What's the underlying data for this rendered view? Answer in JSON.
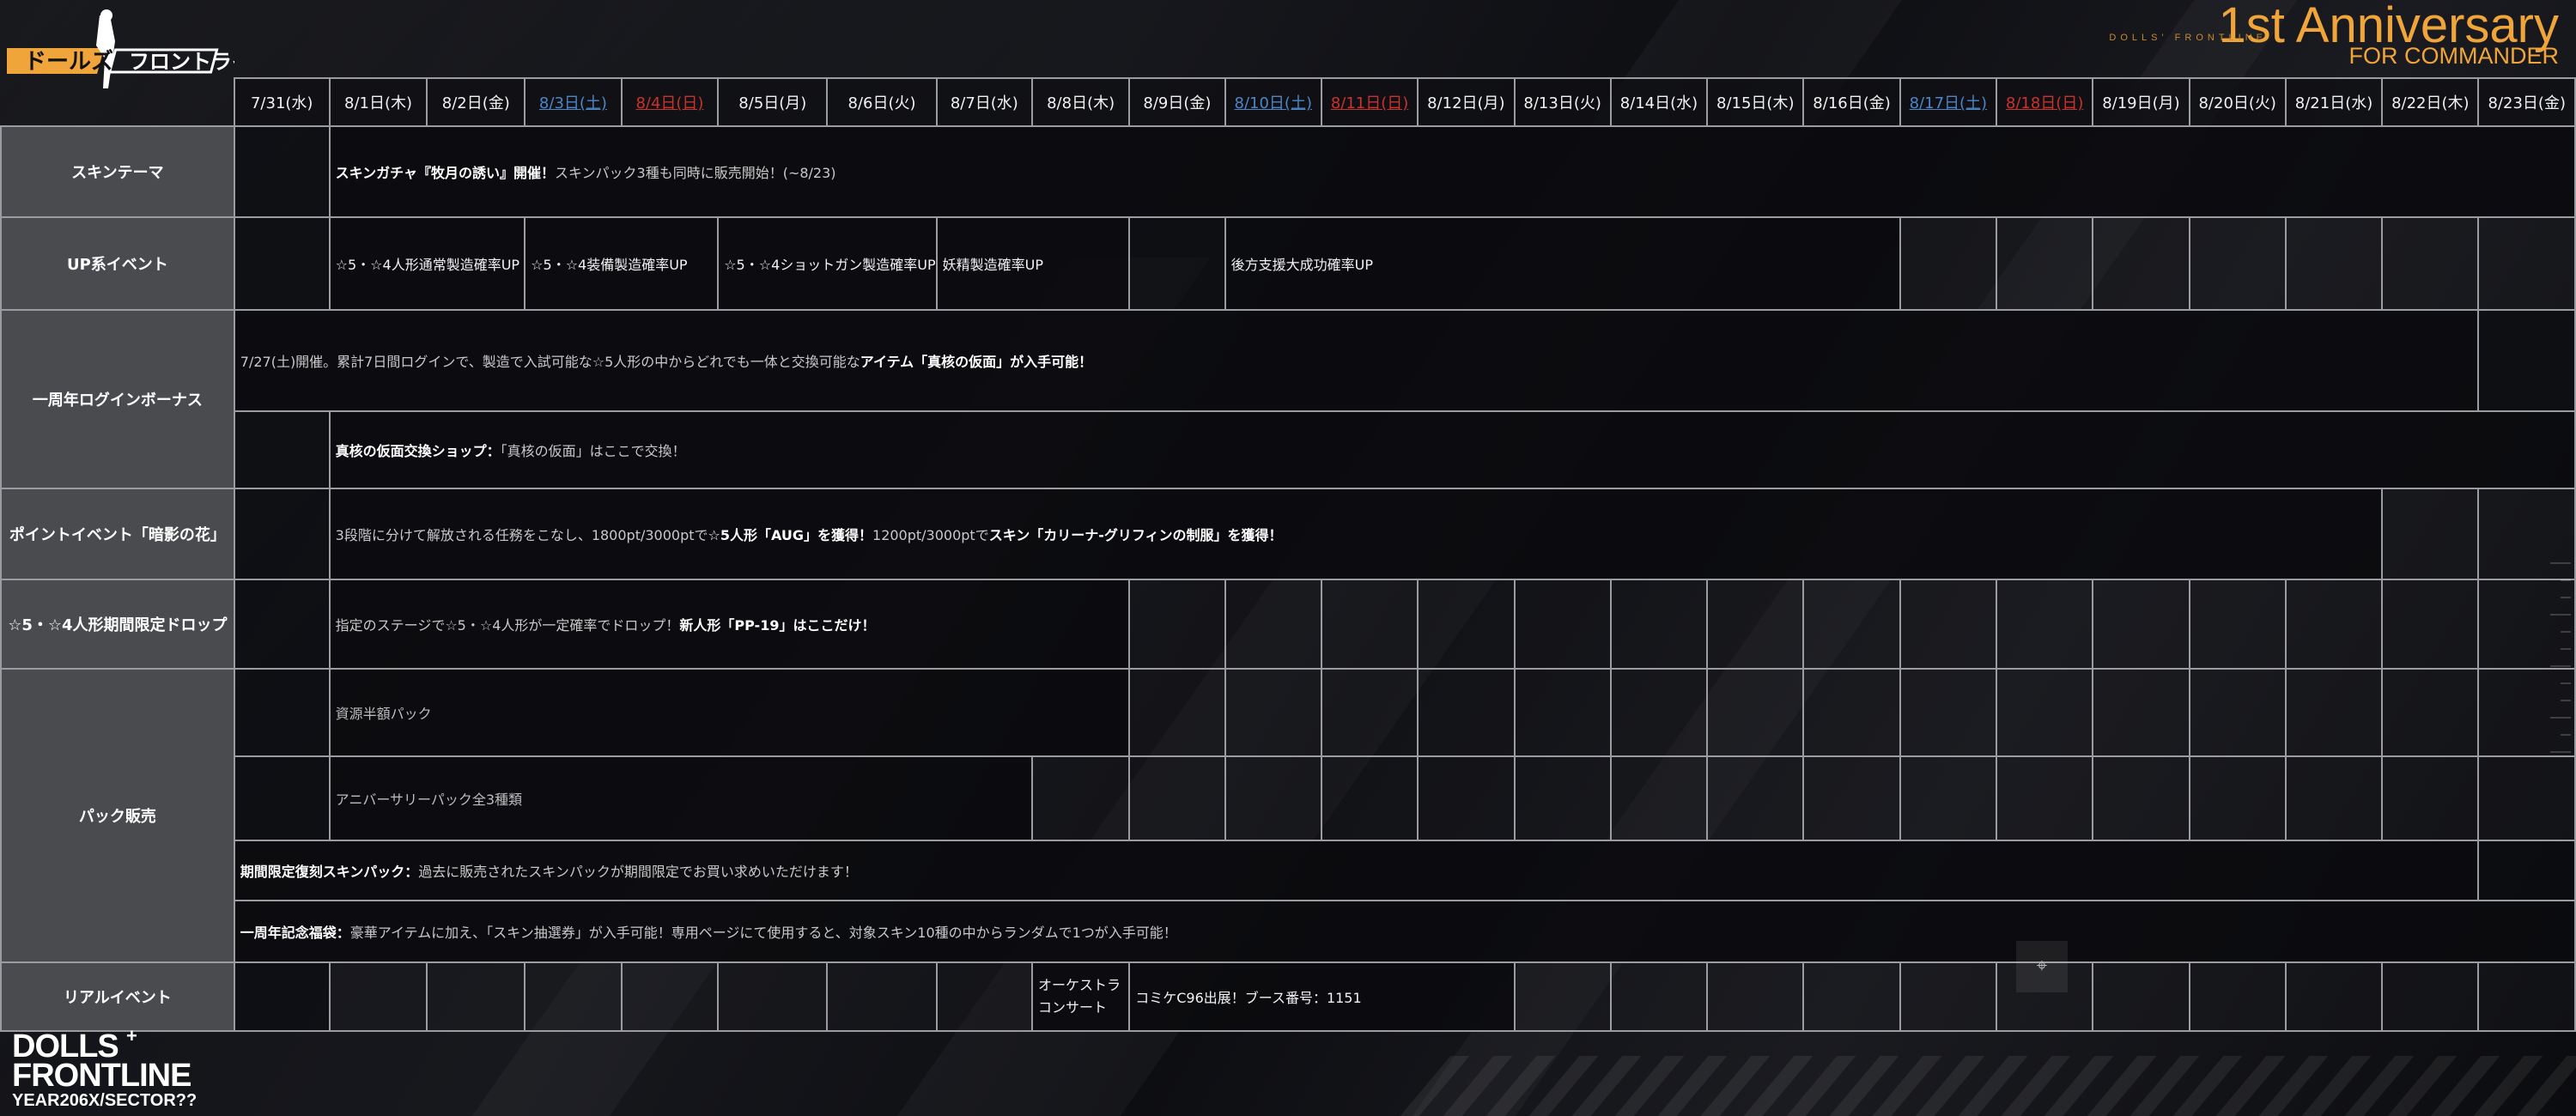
{
  "header": {
    "logo_jp_text": "ドールズフロントライン",
    "brand_small": "DOLLS' FRONTLINE",
    "anniversary_title": "1st Anniversary",
    "anniversary_sub": "FOR COMMANDER"
  },
  "dates": [
    {
      "label": "7/31(水)",
      "kind": "normal"
    },
    {
      "label": "8/1日(木)",
      "kind": "normal"
    },
    {
      "label": "8/2日(金)",
      "kind": "normal"
    },
    {
      "label": "8/3日(土)",
      "kind": "sat"
    },
    {
      "label": "8/4日(日)",
      "kind": "sun"
    },
    {
      "label": "8/5日(月)",
      "kind": "normal"
    },
    {
      "label": "8/6日(火)",
      "kind": "normal"
    },
    {
      "label": "8/7日(水)",
      "kind": "normal"
    },
    {
      "label": "8/8日(木)",
      "kind": "normal"
    },
    {
      "label": "8/9日(金)",
      "kind": "normal"
    },
    {
      "label": "8/10日(土)",
      "kind": "sat"
    },
    {
      "label": "8/11日(日)",
      "kind": "sun"
    },
    {
      "label": "8/12日(月)",
      "kind": "normal"
    },
    {
      "label": "8/13日(火)",
      "kind": "normal"
    },
    {
      "label": "8/14日(水)",
      "kind": "normal"
    },
    {
      "label": "8/15日(木)",
      "kind": "normal"
    },
    {
      "label": "8/16日(金)",
      "kind": "normal"
    },
    {
      "label": "8/17日(土)",
      "kind": "sat"
    },
    {
      "label": "8/18日(日)",
      "kind": "sun"
    },
    {
      "label": "8/19日(月)",
      "kind": "normal"
    },
    {
      "label": "8/20日(火)",
      "kind": "normal"
    },
    {
      "label": "8/21日(水)",
      "kind": "normal"
    },
    {
      "label": "8/22日(木)",
      "kind": "normal"
    },
    {
      "label": "8/23日(金)",
      "kind": "normal"
    }
  ],
  "rows": {
    "skin_theme": {
      "label": "スキンテーマ",
      "event_bold": "スキンガチャ『牧月の誘い』開催！",
      "event_rest": "スキンパック3種も同時に販売開始！(~8/23)"
    },
    "up_events": {
      "label": "UP系イベント",
      "items": [
        "☆5・☆4人形通常製造確率UP",
        "☆5・☆4装備製造確率UP",
        "☆5・☆4ショットガン製造確率UP",
        "妖精製造確率UP",
        "後方支援大成功確率UP"
      ]
    },
    "login_bonus": {
      "label": "一周年ログインボーナス",
      "line1_rest": "7/27(土)開催。累計7日間ログインで、製造で入試可能な☆5人形の中からどれでも一体と交換可能な",
      "line1_bold": "アイテム「真核の仮面」が入手可能！",
      "line2_bold": "真核の仮面交換ショップ：",
      "line2_rest": "「真核の仮面」はここで交換！"
    },
    "point_event": {
      "label": "ポイントイベント「暗影の花」",
      "text_rest": "3段階に分けて解放される任務をこなし、1800pt/3000ptで",
      "text_bold1": "☆5人形「AUG」を獲得！",
      "text_rest2": "1200pt/3000ptで",
      "text_bold2": "スキン「カリーナ-グリフィンの制服」を獲得！"
    },
    "limited_drop": {
      "label": "☆5・☆4人形期間限定ドロップ",
      "text_rest": "指定のステージで☆5・☆4人形が一定確率でドロップ！",
      "text_bold": "新人形「PP-19」はここだけ！"
    },
    "pack_sales": {
      "label": "パック販売",
      "pack1": "資源半額パック",
      "pack2": "アニバーサリーパック全3種類",
      "pack3_bold": "期間限定復刻スキンパック：",
      "pack3_rest": "過去に販売されたスキンパックが期間限定でお買い求めいただけます！",
      "pack4_bold": "一周年記念福袋：",
      "pack4_rest": "豪華アイテムに加え、「スキン抽選券」が入手可能！専用ページにて使用すると、対象スキン10種の中からランダムで1つが入手可能！"
    },
    "real_event": {
      "label": "リアルイベント",
      "orchestra_line1": "オーケストラ",
      "orchestra_line2": "コンサート",
      "comiket": "コミケC96出展！ブース番号：1151"
    }
  },
  "footer": {
    "logo_line1": "DOLLS",
    "logo_plus": "+",
    "logo_line2": "FRONTLINE",
    "logo_line3": "YEAR206X/SECTOR??"
  },
  "colors": {
    "accent_orange": "#f0a53a",
    "saturday_blue": "#4c86c6",
    "sunday_red": "#c9332d",
    "row_header_gray": "#4a4b4f"
  }
}
